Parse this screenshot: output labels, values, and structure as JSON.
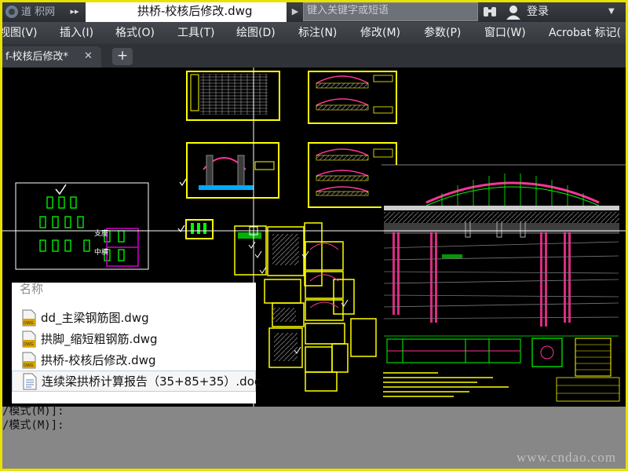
{
  "titlebar": {
    "logo_text": "道 积网",
    "nav_arrows": "▸▸",
    "document_title": "拱桥-校核后修改.dwg",
    "search_placeholder": "键入关键字或短语",
    "login_label": "登录"
  },
  "menu": {
    "items": [
      {
        "label": "视图(V)"
      },
      {
        "label": "插入(I)"
      },
      {
        "label": "格式(O)"
      },
      {
        "label": "工具(T)"
      },
      {
        "label": "绘图(D)"
      },
      {
        "label": "标注(N)"
      },
      {
        "label": "修改(M)"
      },
      {
        "label": "参数(P)"
      },
      {
        "label": "窗口(W)"
      },
      {
        "label": "Acrobat 标记("
      }
    ]
  },
  "tabs": {
    "active_label": "f-校核后修改*",
    "close_symbol": "✕",
    "add_symbol": "+"
  },
  "drawing": {
    "side_labels": [
      "支座",
      "中横"
    ]
  },
  "file_panel": {
    "header": "名称",
    "files": [
      {
        "name": "dd_主梁钢筋图.dwg",
        "type": "dwg",
        "icon": "dwg-file-icon"
      },
      {
        "name": "拱脚_缩短粗钢筋.dwg",
        "type": "dwg",
        "icon": "dwg-file-icon"
      },
      {
        "name": "拱桥-校核后修改.dwg",
        "type": "dwg",
        "icon": "dwg-file-icon"
      },
      {
        "name": "连续梁拱桥计算报告（35+85+35）.doc",
        "type": "doc",
        "icon": "doc-file-icon"
      }
    ]
  },
  "command": {
    "lines": [
      "/模式(M)]:",
      "/模式(M)]:"
    ]
  },
  "watermark": "www.cndao.com",
  "colors": {
    "drawing_frame": "#ffff00",
    "drawing_line": "#00ff00",
    "drawing_pink": "#ff3399",
    "drawing_magenta": "#d000d0",
    "crosshair": "#ffffff",
    "screenshot_border": "#e8e200"
  }
}
